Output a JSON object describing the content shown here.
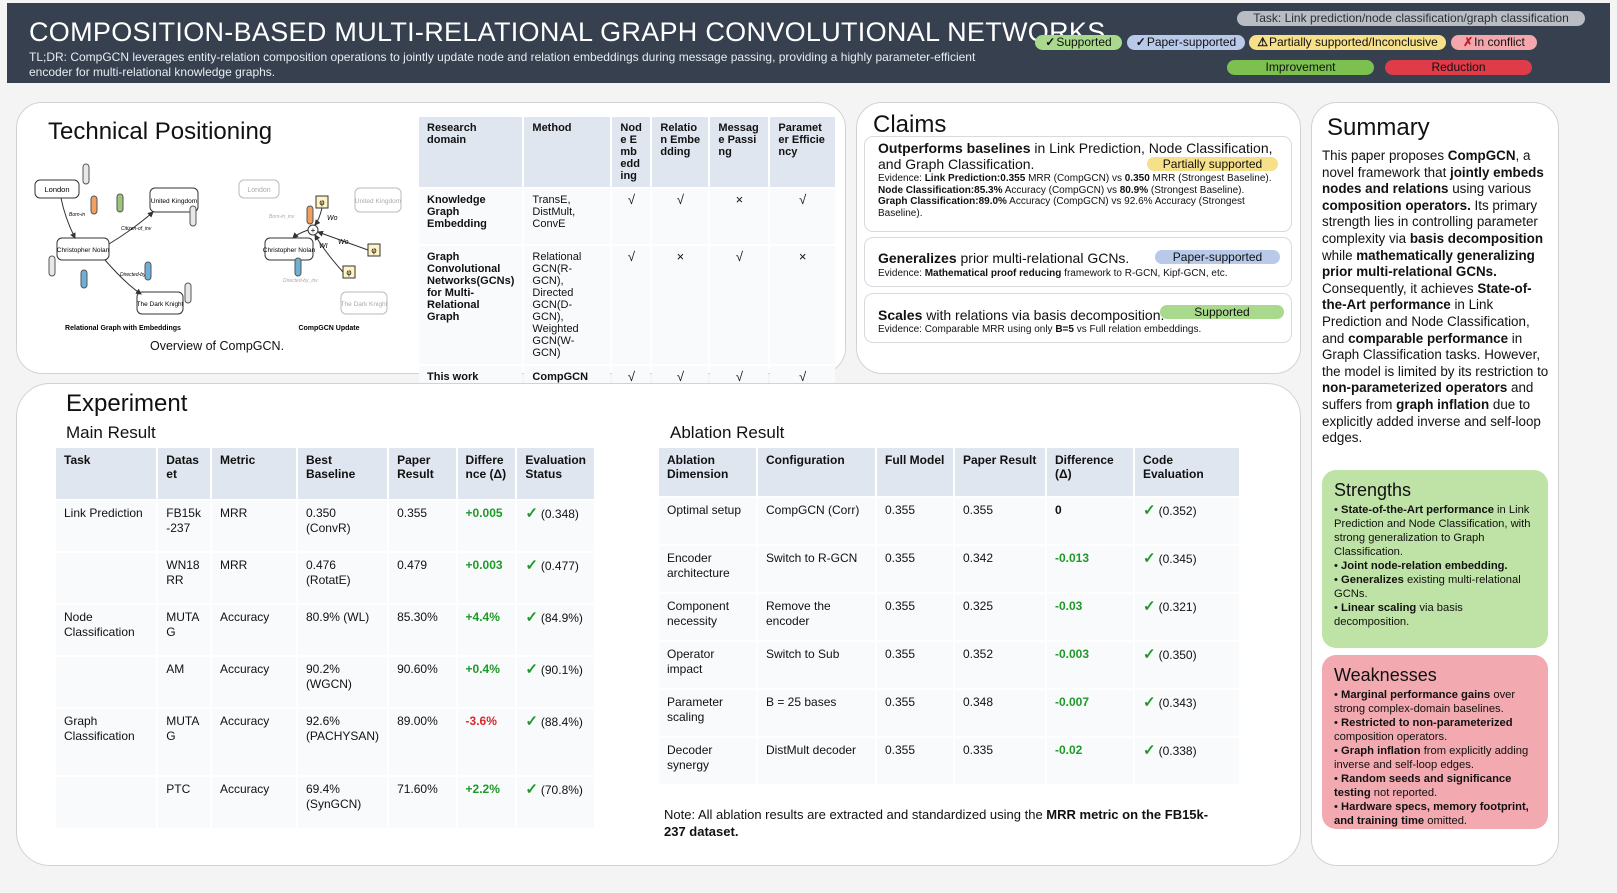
{
  "header": {
    "title": "COMPOSITION-BASED MULTI-RELATIONAL GRAPH CONVOLUTIONAL NETWORKS",
    "tldr": "TL;DR: CompGCN leverages entity-relation composition operations to jointly update node and relation embeddings during message passing, providing a highly parameter-efficient encoder for multi-relational knowledge graphs.",
    "task": "Task: Link prediction/node classification/graph classification",
    "legend": [
      {
        "icon": "✓",
        "label": "Supported",
        "color": "#a9d98c"
      },
      {
        "icon": "✓",
        "label": "Paper-supported",
        "color": "#b8c9ea"
      },
      {
        "icon": "⚠",
        "label": "Partially supported/Inconclusive",
        "color": "#f6e08a"
      },
      {
        "icon": "✗",
        "label": "In conflict",
        "color": "#f3a7ad"
      }
    ],
    "improvement": "Improvement",
    "reduction": "Reduction",
    "colors": {
      "improvement": "#7cc04f",
      "reduction": "#df3b48"
    }
  },
  "positioning": {
    "title": "Technical Positioning",
    "figure_caption": "Overview of CompGCN.",
    "fig_left_caption": "Relational Graph with Embeddings",
    "fig_right_caption": "CompGCN Update",
    "fig_nodes": [
      "London",
      "United Kingdom",
      "Christopher Nolan",
      "The Dark Knight"
    ],
    "fig_edges": [
      "Born-in",
      "Citizen-of",
      "Directed-by",
      "Born-in_inv",
      "Citizen-of_inv",
      "Directed-by_inv"
    ],
    "headers": [
      "Research domain",
      "Method",
      "Node Embedding",
      "Relation Embedding",
      "Message Passing",
      "Parameter Efficiency"
    ],
    "rows": [
      {
        "domain": "Knowledge Graph Embedding",
        "method": "TransE, DistMult, ConvE",
        "marks": [
          "√",
          "√",
          "×",
          "√"
        ]
      },
      {
        "domain": "Graph Convolutional Networks(GCNs) for Multi-Relational Graph",
        "method": "Relational GCN(R-GCN), Directed GCN(D-GCN), Weighted GCN(W-GCN)",
        "marks": [
          "√",
          "×",
          "√",
          "×"
        ]
      },
      {
        "domain": "This work",
        "method": "CompGCN",
        "marks": [
          "√",
          "√",
          "√",
          "√"
        ]
      }
    ]
  },
  "claims": {
    "title": "Claims",
    "items": [
      {
        "bold": "Outperforms baselines",
        "rest": " in Link Prediction, Node Classification, and Graph Classification.",
        "status": "Partially supported",
        "evidence": [
          {
            "label": "Evidence: ",
            "b1": "Link Prediction:0.355",
            "t1": " MRR (CompGCN) vs ",
            "b2": "0.350",
            "t2": " MRR (Strongest Baseline)."
          },
          {
            "label": "",
            "b1": "Node Classification:85.3%",
            "t1": " Accuracy (CompGCN) vs ",
            "b2": "80.9%",
            "t2": " (Strongest Baseline)."
          },
          {
            "label": "",
            "b1": "Graph Classification:89.0%",
            "t1": " Accuracy (CompGCN) vs 92.6% Accuracy (Strongest Baseline).",
            "b2": "",
            "t2": ""
          }
        ]
      },
      {
        "bold": "Generalizes",
        "rest": " prior multi-relational GCNs.",
        "status": "Paper-supported",
        "evidence": [
          {
            "label": "Evidence: ",
            "b1": "Mathematical proof reducing",
            "t1": " framework to R-GCN, Kipf-GCN, etc.",
            "b2": "",
            "t2": ""
          }
        ]
      },
      {
        "bold": "Scales",
        "rest": " with relations via basis decomposition.",
        "status": "Supported",
        "evidence": [
          {
            "label": "Evidence: ",
            "b1": "",
            "t1": "Comparable MRR using only ",
            "b2": "B=5",
            "t2": " vs Full relation embeddings."
          }
        ]
      }
    ]
  },
  "summary": {
    "title": "Summary",
    "text": [
      [
        "This paper proposes ",
        0
      ],
      [
        "CompGCN",
        1
      ],
      [
        ", a novel framework that ",
        0
      ],
      [
        "jointly embeds nodes and relations",
        1
      ],
      [
        " using various ",
        0
      ],
      [
        "composition operators.",
        1
      ],
      [
        " Its primary strength lies in controlling parameter complexity via ",
        0
      ],
      [
        "basis decomposition",
        1
      ],
      [
        " while ",
        0
      ],
      [
        "mathematically generalizing prior multi-relational GCNs.",
        1
      ],
      [
        " Consequently, it achieves ",
        0
      ],
      [
        "State-of-the-Art performance",
        1
      ],
      [
        " in Link Prediction and Node Classification, and ",
        0
      ],
      [
        "comparable performance",
        1
      ],
      [
        " in Graph Classification tasks. However, the model is limited by its restriction to ",
        0
      ],
      [
        "non-parameterized operators",
        1
      ],
      [
        " and suffers from ",
        0
      ],
      [
        "graph inflation",
        1
      ],
      [
        " due to explicitly added inverse and self-loop edges.",
        0
      ]
    ],
    "strengths_title": "Strengths",
    "strengths": [
      [
        [
          "State-of-the-Art performance",
          1
        ],
        [
          " in Link Prediction and Node Classification, with strong generalization to Graph Classification.",
          0
        ]
      ],
      [
        [
          "Joint node-relation embedding.",
          1
        ]
      ],
      [
        [
          "Generalizes",
          1
        ],
        [
          " existing multi-relational GCNs.",
          0
        ]
      ],
      [
        [
          "Linear scaling",
          1
        ],
        [
          " via basis decomposition.",
          0
        ]
      ]
    ],
    "weaknesses_title": "Weaknesses",
    "weaknesses": [
      [
        [
          "Marginal performance gains",
          1
        ],
        [
          " over strong complex-domain baselines.",
          0
        ]
      ],
      [
        [
          "Restricted to non-parameterized",
          1
        ],
        [
          " composition operators.",
          0
        ]
      ],
      [
        [
          "Graph inflation",
          1
        ],
        [
          " from explicitly adding inverse and self-loop edges.",
          0
        ]
      ],
      [
        [
          "Random seeds and significance testing",
          1
        ],
        [
          " not reported.",
          0
        ]
      ],
      [
        [
          "Hardware specs, memory footprint, and training time",
          1
        ],
        [
          " omitted.",
          0
        ]
      ]
    ]
  },
  "experiment": {
    "title": "Experiment",
    "main_title": "Main Result",
    "main_headers": [
      "Task",
      "Dataset",
      "Metric",
      "Best Baseline",
      "Paper Result",
      "Difference (Δ)",
      "Evaluation Status"
    ],
    "main_rows": [
      {
        "task": "Link Prediction",
        "dataset": "FB15k-237",
        "metric": "MRR",
        "baseline": "0.350 (ConvR)",
        "result": "0.355",
        "diff": "+0.005",
        "sign": "pos",
        "eval": "(0.348)"
      },
      {
        "task": "",
        "dataset": "WN18RR",
        "metric": "MRR",
        "baseline": "0.476 (RotatE)",
        "result": "0.479",
        "diff": "+0.003",
        "sign": "pos",
        "eval": "(0.477)"
      },
      {
        "task": "Node Classification",
        "dataset": "MUTAG",
        "metric": "Accuracy",
        "baseline": "80.9% (WL)",
        "result": "85.30%",
        "diff": "+4.4%",
        "sign": "pos",
        "eval": "(84.9%)"
      },
      {
        "task": "",
        "dataset": "AM",
        "metric": "Accuracy",
        "baseline": "90.2% (WGCN)",
        "result": "90.60%",
        "diff": "+0.4%",
        "sign": "pos",
        "eval": "(90.1%)"
      },
      {
        "task": "Graph Classification",
        "dataset": "MUTAG",
        "metric": "Accuracy",
        "baseline": "92.6% (PACHYSAN)",
        "result": "89.00%",
        "diff": "-3.6%",
        "sign": "neg",
        "eval": "(88.4%)"
      },
      {
        "task": "",
        "dataset": "PTC",
        "metric": "Accuracy",
        "baseline": "69.4% (SynGCN)",
        "result": "71.60%",
        "diff": "+2.2%",
        "sign": "pos",
        "eval": "(70.8%)"
      }
    ],
    "ablation_title": "Ablation Result",
    "ablation_headers": [
      "Ablation Dimension",
      "Configuration",
      "Full Model",
      "Paper Result",
      "Difference (Δ)",
      "Code Evaluation"
    ],
    "ablation_rows": [
      {
        "dim": "Optimal setup",
        "config": "CompGCN (Corr)",
        "full": "0.355",
        "result": "0.355",
        "diff": "0",
        "sign": "zero",
        "eval": "(0.352)"
      },
      {
        "dim": "Encoder architecture",
        "config": "Switch to R-GCN",
        "full": "0.355",
        "result": "0.342",
        "diff": "-0.013",
        "sign": "pos",
        "eval": "(0.345)"
      },
      {
        "dim": "Component necessity",
        "config": "Remove the encoder",
        "full": "0.355",
        "result": "0.325",
        "diff": "-0.03",
        "sign": "pos",
        "eval": "(0.321)"
      },
      {
        "dim": "Operator impact",
        "config": "Switch to Sub",
        "full": "0.355",
        "result": "0.352",
        "diff": "-0.003",
        "sign": "pos",
        "eval": "(0.350)"
      },
      {
        "dim": "Parameter scaling",
        "config": "B = 25 bases",
        "full": "0.355",
        "result": "0.348",
        "diff": "-0.007",
        "sign": "pos",
        "eval": "(0.343)"
      },
      {
        "dim": "Decoder synergy",
        "config": "DistMult decoder",
        "full": "0.355",
        "result": "0.335",
        "diff": "-0.02",
        "sign": "pos",
        "eval": "(0.338)"
      }
    ],
    "note_plain": "Note: All ablation results are extracted and standardized using the ",
    "note_bold": "MRR metric on the FB15k-237 dataset."
  }
}
